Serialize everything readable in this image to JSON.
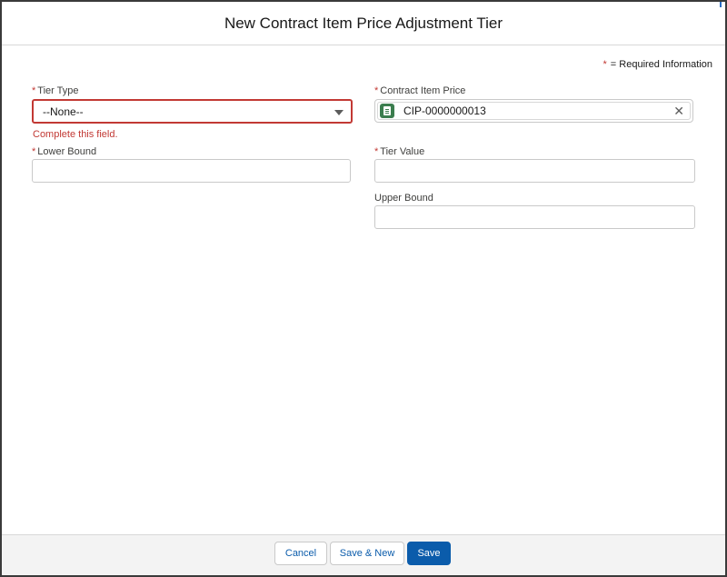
{
  "modal": {
    "title": "New Contract Item Price Adjustment Tier",
    "required_legend": "= Required Information",
    "required_marker": "*"
  },
  "fields": {
    "tier_type": {
      "label": "Tier Type",
      "value": "--None--",
      "error": "Complete this field."
    },
    "contract_item_price": {
      "label": "Contract Item Price",
      "value": "CIP-0000000013"
    },
    "lower_bound": {
      "label": "Lower Bound",
      "value": ""
    },
    "tier_value": {
      "label": "Tier Value",
      "value": ""
    },
    "upper_bound": {
      "label": "Upper Bound",
      "value": ""
    }
  },
  "footer": {
    "cancel_label": "Cancel",
    "save_new_label": "Save & New",
    "save_label": "Save"
  },
  "colors": {
    "brand": "#0b5cab",
    "error": "#c23934",
    "record_icon": "#3b7d4e"
  },
  "icons": {
    "lookup_record": "record-icon",
    "clear": "close-icon",
    "dropdown": "chevron-down-icon"
  }
}
